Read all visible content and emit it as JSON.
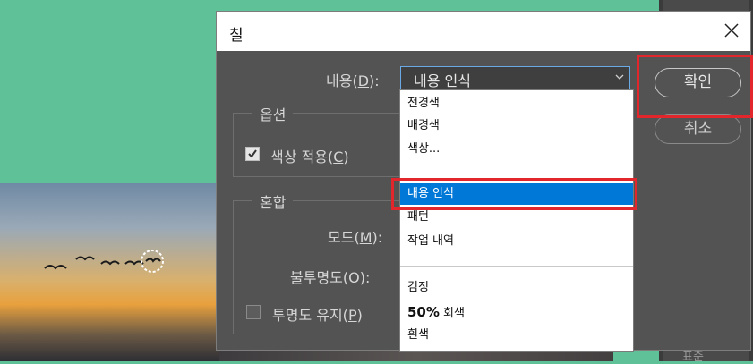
{
  "dialog": {
    "title": "칠",
    "content_label": "내용(",
    "content_mnemonic": "D",
    "content_label_end": "):",
    "content_value": "내용 인식",
    "options_group": "옵션",
    "color_adapt_label": "색상 적용(",
    "color_adapt_mnemonic": "C",
    "color_adapt_end": ")",
    "color_adapt_checked": true,
    "blend_group": "혼합",
    "mode_label": "모드(",
    "mode_mnemonic": "M",
    "mode_end": "):",
    "opacity_label": "불투명도(",
    "opacity_mnemonic": "O",
    "opacity_end": "):",
    "preserve_label": "투명도 유지(",
    "preserve_mnemonic": "P",
    "preserve_end": ")",
    "preserve_checked": false,
    "ok_label": "확인",
    "cancel_label": "취소"
  },
  "dropdown": {
    "groups": [
      [
        "전경색",
        "배경색",
        "색상..."
      ],
      [
        "내용 인식",
        "패턴",
        "작업 내역"
      ],
      [
        "검정",
        "50% 회색",
        "흰색"
      ]
    ],
    "item_foreground": "전경색",
    "item_background": "배경색",
    "item_color": "색상...",
    "item_content_aware": "내용 인식",
    "item_pattern": "패턴",
    "item_history": "작업 내역",
    "item_black": "검정",
    "item_gray_pct": "50%",
    "item_gray_word": "회색",
    "item_white": "흰색",
    "selected": "내용 인식"
  },
  "background": {
    "strip_text": "표준"
  },
  "colors": {
    "highlight_red": "#e3262b",
    "selection_blue": "#0078d7",
    "canvas_green": "#5fc197"
  },
  "icons": {
    "close": "close-icon",
    "chevron": "chevron-down-icon",
    "check": "check-icon"
  }
}
